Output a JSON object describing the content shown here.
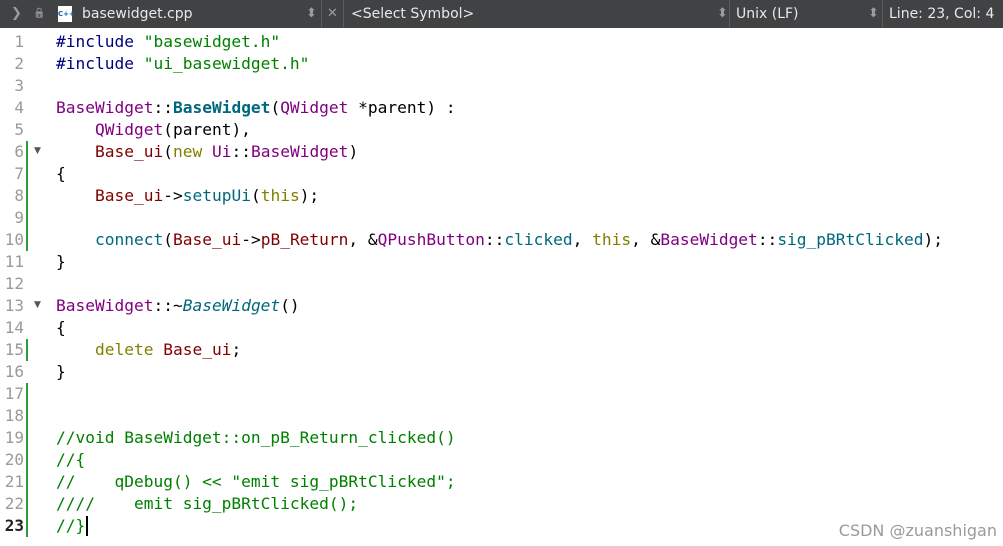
{
  "toolbar": {
    "back_glyph": "❯",
    "lock_glyph": "🔒",
    "file_icon_text": "C++",
    "filename": "basewidget.cpp",
    "file_dropdown_glyph": "⬍",
    "close_glyph": "✕",
    "symbol": "<Select Symbol>",
    "symbol_dropdown_glyph": "⬍",
    "line_ending": "Unix (LF)",
    "line_ending_dropdown_glyph": "⬍",
    "position": "Line: 23, Col: 4"
  },
  "editor": {
    "current_line": 23,
    "line_numbers": [
      "1",
      "2",
      "3",
      "4",
      "5",
      "6",
      "7",
      "8",
      "9",
      "10",
      "11",
      "12",
      "13",
      "14",
      "15",
      "16",
      "17",
      "18",
      "19",
      "20",
      "21",
      "22",
      "23"
    ],
    "fold_markers": [
      6,
      13
    ],
    "fold_glyph": "▼",
    "changed_ranges": [
      [
        6,
        10
      ],
      [
        15,
        15
      ],
      [
        17,
        23
      ]
    ],
    "lines": [
      [
        {
          "t": "#include ",
          "c": "pp"
        },
        {
          "t": "\"basewidget.h\"",
          "c": "str"
        }
      ],
      [
        {
          "t": "#include ",
          "c": "pp"
        },
        {
          "t": "\"ui_basewidget.h\"",
          "c": "str"
        }
      ],
      [],
      [
        {
          "t": "BaseWidget",
          "c": "cls"
        },
        {
          "t": "::"
        },
        {
          "t": "BaseWidget",
          "c": "fn b"
        },
        {
          "t": "("
        },
        {
          "t": "QWidget",
          "c": "cls"
        },
        {
          "t": " *parent) :"
        }
      ],
      [
        {
          "t": "    "
        },
        {
          "t": "QWidget",
          "c": "cls"
        },
        {
          "t": "(parent),"
        }
      ],
      [
        {
          "t": "    "
        },
        {
          "t": "Base_ui",
          "c": "mem"
        },
        {
          "t": "("
        },
        {
          "t": "new",
          "c": "kw"
        },
        {
          "t": " "
        },
        {
          "t": "Ui",
          "c": "cls"
        },
        {
          "t": "::"
        },
        {
          "t": "BaseWidget",
          "c": "cls"
        },
        {
          "t": ")"
        }
      ],
      [
        {
          "t": "{"
        }
      ],
      [
        {
          "t": "    "
        },
        {
          "t": "Base_ui",
          "c": "mem"
        },
        {
          "t": "->"
        },
        {
          "t": "setupUi",
          "c": "fn"
        },
        {
          "t": "("
        },
        {
          "t": "this",
          "c": "kw"
        },
        {
          "t": ");"
        }
      ],
      [],
      [
        {
          "t": "    "
        },
        {
          "t": "connect",
          "c": "fn"
        },
        {
          "t": "("
        },
        {
          "t": "Base_ui",
          "c": "mem"
        },
        {
          "t": "->"
        },
        {
          "t": "pB_Return",
          "c": "mem"
        },
        {
          "t": ", &"
        },
        {
          "t": "QPushButton",
          "c": "cls"
        },
        {
          "t": "::"
        },
        {
          "t": "clicked",
          "c": "fn"
        },
        {
          "t": ", "
        },
        {
          "t": "this",
          "c": "kw"
        },
        {
          "t": ", &"
        },
        {
          "t": "BaseWidget",
          "c": "cls"
        },
        {
          "t": "::"
        },
        {
          "t": "sig_pBRtClicked",
          "c": "fn"
        },
        {
          "t": ");"
        }
      ],
      [
        {
          "t": "}"
        }
      ],
      [],
      [
        {
          "t": "BaseWidget",
          "c": "cls"
        },
        {
          "t": "::~"
        },
        {
          "t": "BaseWidget",
          "c": "fn it"
        },
        {
          "t": "()"
        }
      ],
      [
        {
          "t": "{"
        }
      ],
      [
        {
          "t": "    "
        },
        {
          "t": "delete",
          "c": "kw"
        },
        {
          "t": " "
        },
        {
          "t": "Base_ui",
          "c": "mem"
        },
        {
          "t": ";"
        }
      ],
      [
        {
          "t": "}"
        }
      ],
      [],
      [],
      [
        {
          "t": "//void BaseWidget::on_pB_Return_clicked()",
          "c": "cmt"
        }
      ],
      [
        {
          "t": "//{",
          "c": "cmt"
        }
      ],
      [
        {
          "t": "//    qDebug() << \"emit sig_pBRtClicked\";",
          "c": "cmt"
        }
      ],
      [
        {
          "t": "////    emit sig_pBRtClicked();",
          "c": "cmt"
        }
      ],
      [
        {
          "t": "//}",
          "c": "cmt"
        }
      ]
    ]
  },
  "watermark": "CSDN @zuanshigan"
}
